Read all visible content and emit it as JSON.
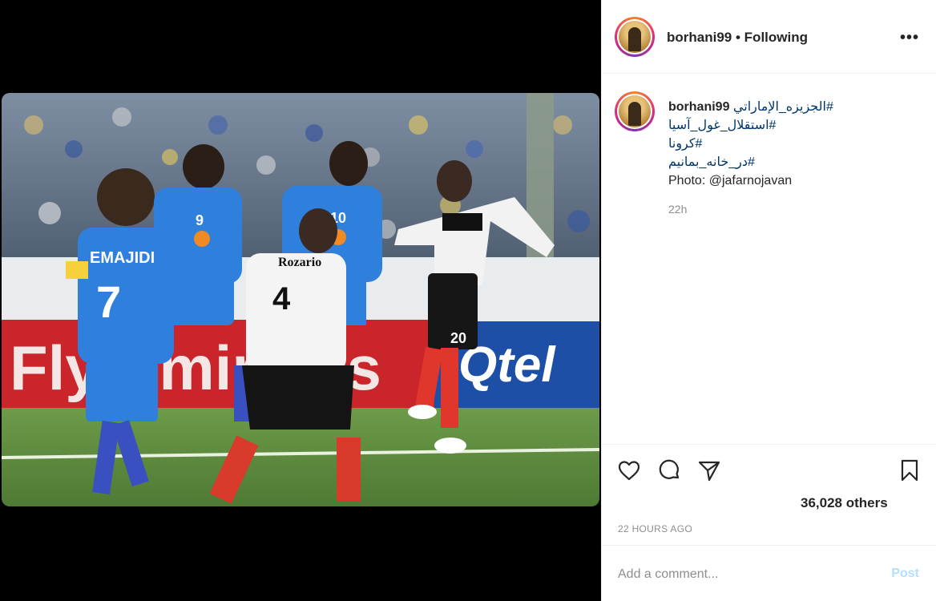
{
  "post": {
    "username": "borhani99",
    "separator": "•",
    "follow_status": "Following",
    "more_icon": "more-options-icon"
  },
  "caption": {
    "username": "borhani99",
    "lines": [
      "#الجزيزه_الإماراتي",
      "#استقلال_غول_آسيا",
      "#کرونا",
      "#در_خانه_بمانیم",
      "Photo: @jafarnojavan"
    ],
    "time_ago": "22h"
  },
  "actions": {
    "icons": [
      "heart-icon",
      "comment-icon",
      "share-icon",
      "bookmark-icon"
    ],
    "likes_text": "36,028 others",
    "timestamp": "22 HOURS AGO"
  },
  "comment": {
    "placeholder": "Add a comment...",
    "post_label": "Post"
  },
  "photo": {
    "players_text": {
      "blue_7_name": "EMAJIDI",
      "blue_7_number": "7",
      "blue_9_number": "9",
      "blue_10_number": "10",
      "white_4_name": "Rozario",
      "white_4_number": "4",
      "white_right_number": "20"
    },
    "ad_text_left": "Fly Emirates",
    "ad_text_right": "Qtel"
  },
  "colors": {
    "accent_link": "#00376b",
    "post_button_disabled": "#b2dffc",
    "muted": "#8e8e8e"
  }
}
